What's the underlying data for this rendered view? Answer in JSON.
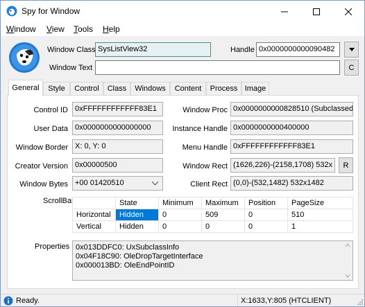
{
  "window": {
    "title": "Spy for Window"
  },
  "menu": {
    "items": [
      "Window",
      "View",
      "Tools",
      "Help"
    ],
    "underline": [
      "W",
      "V",
      "T",
      "H"
    ]
  },
  "header": {
    "class_label": "Window Class",
    "class_value": "SysListView32",
    "handle_label": "Handle",
    "handle_value": "0x0000000000090482",
    "text_label": "Window Text",
    "text_value": "",
    "c_button": "C"
  },
  "tabs": [
    "General",
    "Style",
    "Control",
    "Class",
    "Windows",
    "Content",
    "Process",
    "Image"
  ],
  "general": {
    "control_id_label": "Control ID",
    "control_id": "0xFFFFFFFFFFFF83E1",
    "user_data_label": "User Data",
    "user_data": "0x0000000000000000",
    "border_label": "Window Border",
    "border": "X: 0, Y: 0",
    "creator_label": "Creator Version",
    "creator": "0x00000500",
    "bytes_label": "Window Bytes",
    "bytes": "+00  01420510",
    "proc_label": "Window Proc",
    "proc": "0x0000000000828510 (Subclassed)",
    "instance_label": "Instance Handle",
    "instance": "0x0000000000400000",
    "menu_handle_label": "Menu Handle",
    "menu_handle": "0xFFFFFFFFFFFF83E1",
    "rect_label": "Window Rect",
    "rect": "(1626,226)-(2158,1708) 532x",
    "r_button": "R",
    "client_label": "Client Rect",
    "client": "(0,0)-(532,1482) 532x1482"
  },
  "scrollbar": {
    "label": "ScrollBar",
    "columns": [
      "",
      "State",
      "Minimum",
      "Maximum",
      "Position",
      "PageSize"
    ],
    "rows": [
      [
        "Horizontal",
        "Hidden",
        "0",
        "509",
        "0",
        "510"
      ],
      [
        "Vertical",
        "Hidden",
        "0",
        "0",
        "0",
        "1"
      ]
    ]
  },
  "properties": {
    "label": "Properties",
    "lines": [
      "0x013DDFC0: UxSubclassInfo",
      "0x04F18C90: OleDropTargetInterface",
      "0x000013BD: OleEndPointID"
    ]
  },
  "status": {
    "left": "Ready.",
    "right": "X:1633,Y:805 (HTCLIENT)"
  },
  "colors": {
    "selection": "#0078d7",
    "accent_field": "#e6f1f3"
  }
}
